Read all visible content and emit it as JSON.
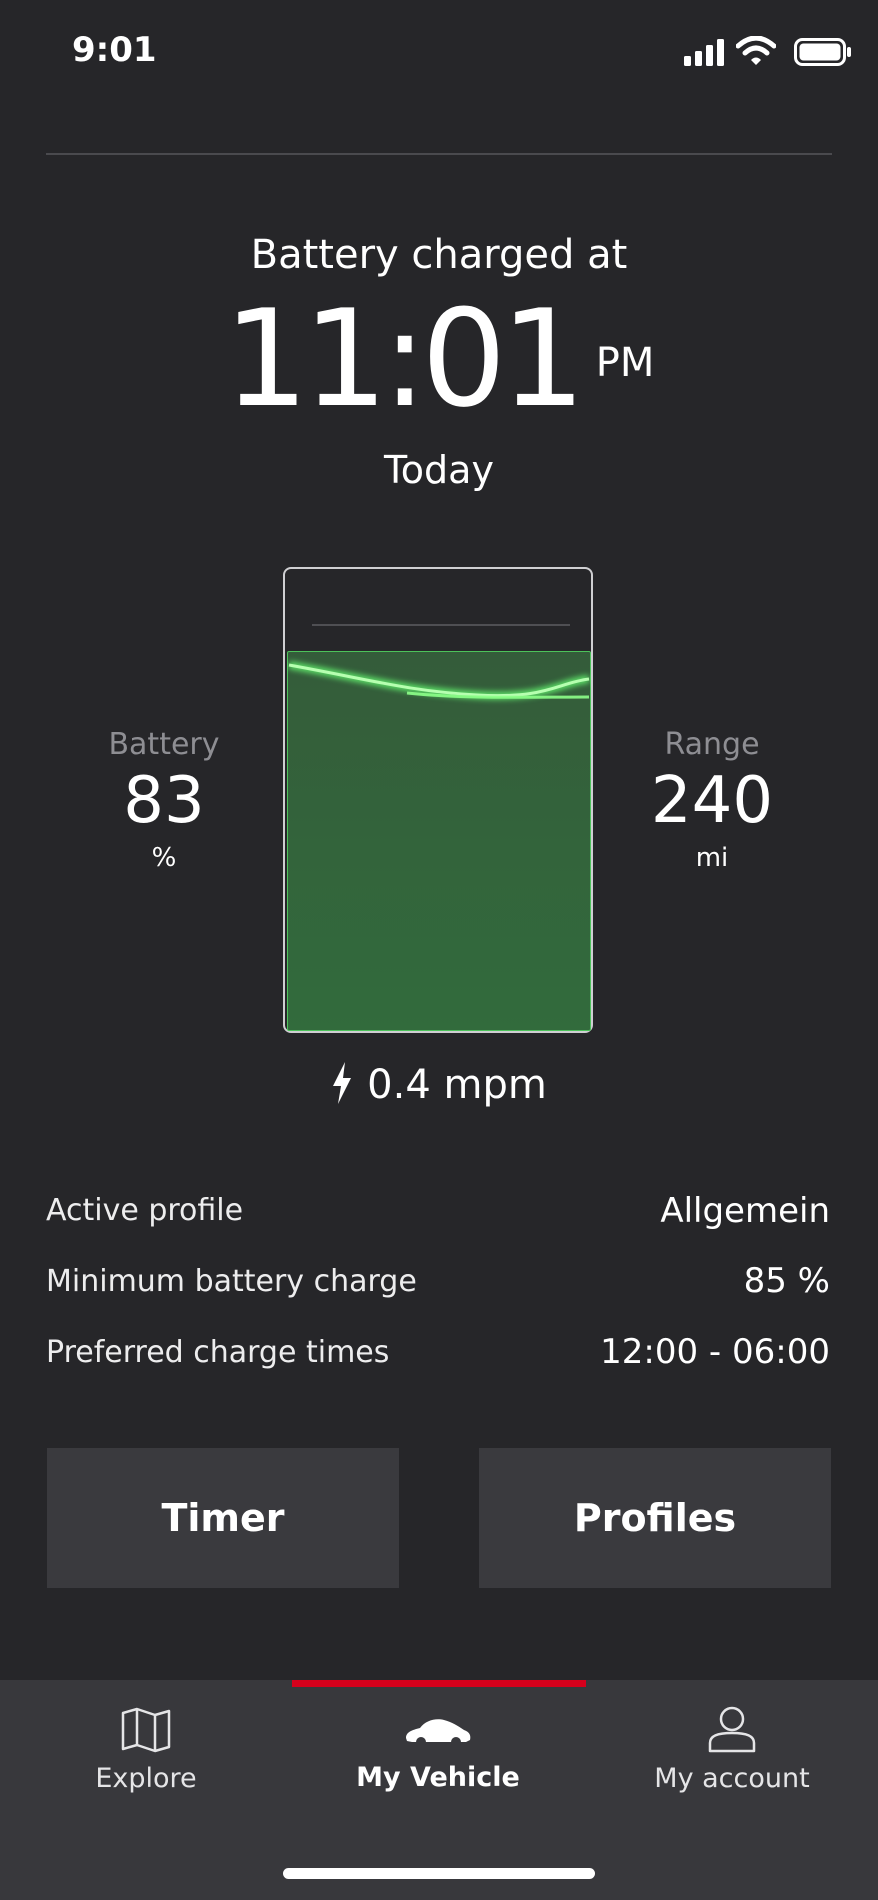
{
  "status_bar": {
    "time": "9:01",
    "icons": [
      "signal-icon",
      "wifi-icon",
      "battery-icon"
    ]
  },
  "charge": {
    "headline": "Battery charged at",
    "time": "11:01",
    "ampm": "PM",
    "day": "Today",
    "rate": "0.4 mpm"
  },
  "battery": {
    "label": "Battery",
    "value": "83",
    "unit": "%",
    "fill_level": 0.83
  },
  "range": {
    "label": "Range",
    "value": "240",
    "unit": "mi"
  },
  "info_rows": [
    {
      "label": "Active profile",
      "value": "Allgemein"
    },
    {
      "label": "Minimum battery charge",
      "value": "85 %"
    },
    {
      "label": "Preferred charge times",
      "value": "12:00 - 06:00"
    }
  ],
  "buttons": {
    "timer": "Timer",
    "profiles": "Profiles"
  },
  "tabs": [
    {
      "label": "Explore",
      "icon": "map-icon",
      "active": false
    },
    {
      "label": "My Vehicle",
      "icon": "car-icon",
      "active": true
    },
    {
      "label": "My account",
      "icon": "user-icon",
      "active": false
    }
  ],
  "colors": {
    "background": "#262629",
    "accent": "#d5001c",
    "charge_green": "#4cc25a"
  }
}
